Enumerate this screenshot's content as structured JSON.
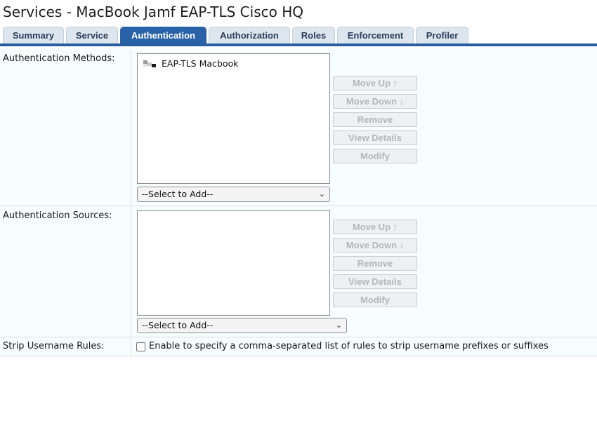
{
  "page": {
    "title": "Services - MacBook Jamf EAP-TLS Cisco HQ"
  },
  "tabs": [
    {
      "label": "Summary"
    },
    {
      "label": "Service"
    },
    {
      "label": "Authentication",
      "active": true
    },
    {
      "label": "Authorization"
    },
    {
      "label": "Roles"
    },
    {
      "label": "Enforcement"
    },
    {
      "label": "Profiler"
    }
  ],
  "auth_methods": {
    "label": "Authentication Methods:",
    "items": [
      {
        "label": "EAP-TLS Macbook",
        "icon": "method-icon"
      }
    ],
    "buttons": {
      "move_up": "Move Up ↑",
      "move_down": "Move Down ↓",
      "remove": "Remove",
      "view_details": "View Details",
      "modify": "Modify"
    },
    "select": "--Select to Add--"
  },
  "auth_sources": {
    "label": "Authentication Sources:",
    "items": [],
    "buttons": {
      "move_up": "Move Up ↑",
      "move_down": "Move Down ↓",
      "remove": "Remove",
      "view_details": "View Details",
      "modify": "Modify"
    },
    "select": "--Select to Add--"
  },
  "strip_rules": {
    "label": "Strip Username Rules:",
    "checkbox_label": "Enable to specify a comma-separated list of rules to strip username prefixes or suffixes",
    "checked": false
  },
  "colors": {
    "tab_active": "#2a62a8",
    "tab_inactive": "#dde5ee",
    "tab_text": "#2b3f5a",
    "row_bg": "#f7fcfd",
    "button_disabled_text": "#b3b8bc"
  }
}
